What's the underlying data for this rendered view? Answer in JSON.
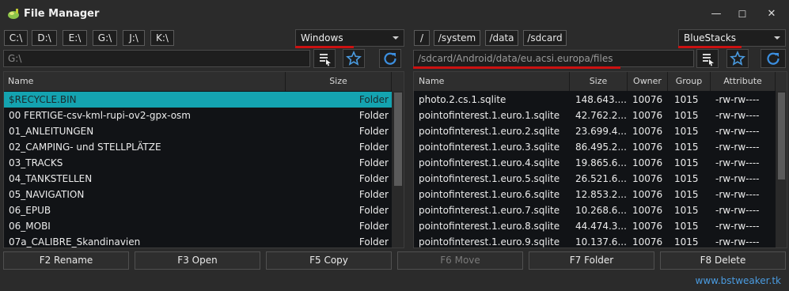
{
  "window": {
    "title": "File Manager",
    "controls": {
      "minimize": "—",
      "maximize": "☐",
      "close": "✕"
    }
  },
  "left": {
    "drives": [
      "C:\\",
      "D:\\",
      "E:\\",
      "G:\\",
      "J:\\",
      "K:\\"
    ],
    "source": "Windows",
    "path_placeholder": "G:\\",
    "columns": {
      "name": "Name",
      "size": "Size"
    },
    "rows": [
      {
        "name": "$RECYCLE.BIN",
        "size": "Folder",
        "selected": true
      },
      {
        "name": "00 FERTIGE-csv-kml-rupi-ov2-gpx-osm",
        "size": "Folder"
      },
      {
        "name": "01_ANLEITUNGEN",
        "size": "Folder"
      },
      {
        "name": "02_CAMPING- und STELLPLÄTZE",
        "size": "Folder"
      },
      {
        "name": "03_TRACKS",
        "size": "Folder"
      },
      {
        "name": "04_TANKSTELLEN",
        "size": "Folder"
      },
      {
        "name": "05_NAVIGATION",
        "size": "Folder"
      },
      {
        "name": "06_EPUB",
        "size": "Folder"
      },
      {
        "name": "06_MOBI",
        "size": "Folder"
      },
      {
        "name": "07a_CALIBRE_Skandinavien",
        "size": "Folder"
      }
    ]
  },
  "right": {
    "roots": [
      "/",
      "/system",
      "/data",
      "/sdcard"
    ],
    "source": "BlueStacks",
    "path_value": "/sdcard/Android/data/eu.acsi.europa/files",
    "columns": {
      "name": "Name",
      "size": "Size",
      "owner": "Owner",
      "group": "Group",
      "attribute": "Attribute"
    },
    "rows": [
      {
        "name": "photo.2.cs.1.sqlite",
        "size": "148.643....",
        "owner": "10076",
        "group": "1015",
        "attribute": "-rw-rw----"
      },
      {
        "name": "pointofinterest.1.euro.1.sqlite",
        "size": "42.762.2...",
        "owner": "10076",
        "group": "1015",
        "attribute": "-rw-rw----"
      },
      {
        "name": "pointofinterest.1.euro.2.sqlite",
        "size": "23.699.4...",
        "owner": "10076",
        "group": "1015",
        "attribute": "-rw-rw----"
      },
      {
        "name": "pointofinterest.1.euro.3.sqlite",
        "size": "86.495.2...",
        "owner": "10076",
        "group": "1015",
        "attribute": "-rw-rw----"
      },
      {
        "name": "pointofinterest.1.euro.4.sqlite",
        "size": "19.865.6...",
        "owner": "10076",
        "group": "1015",
        "attribute": "-rw-rw----"
      },
      {
        "name": "pointofinterest.1.euro.5.sqlite",
        "size": "26.521.6...",
        "owner": "10076",
        "group": "1015",
        "attribute": "-rw-rw----"
      },
      {
        "name": "pointofinterest.1.euro.6.sqlite",
        "size": "12.853.2...",
        "owner": "10076",
        "group": "1015",
        "attribute": "-rw-rw----"
      },
      {
        "name": "pointofinterest.1.euro.7.sqlite",
        "size": "10.268.6...",
        "owner": "10076",
        "group": "1015",
        "attribute": "-rw-rw----"
      },
      {
        "name": "pointofinterest.1.euro.8.sqlite",
        "size": "44.474.3...",
        "owner": "10076",
        "group": "1015",
        "attribute": "-rw-rw----"
      },
      {
        "name": "pointofinterest.1.euro.9.sqlite",
        "size": "10.137.6...",
        "owner": "10076",
        "group": "1015",
        "attribute": "-rw-rw----"
      }
    ]
  },
  "function_keys": [
    {
      "label": "F2 Rename",
      "enabled": true
    },
    {
      "label": "F3 Open",
      "enabled": true
    },
    {
      "label": "F5 Copy",
      "enabled": true
    },
    {
      "label": "F6 Move",
      "enabled": false
    },
    {
      "label": "F7 Folder",
      "enabled": true
    },
    {
      "label": "F8 Delete",
      "enabled": true
    }
  ],
  "credit": "www.bstweaker.tk",
  "colors": {
    "selection": "#14a3b0",
    "highlight_underline": "#cc1111",
    "link": "#4a9be0",
    "refresh_icon": "#3c8fe0"
  },
  "icons": [
    "app-icon",
    "bookmark-list-icon",
    "star-icon",
    "refresh-icon",
    "chevron-down-icon"
  ]
}
